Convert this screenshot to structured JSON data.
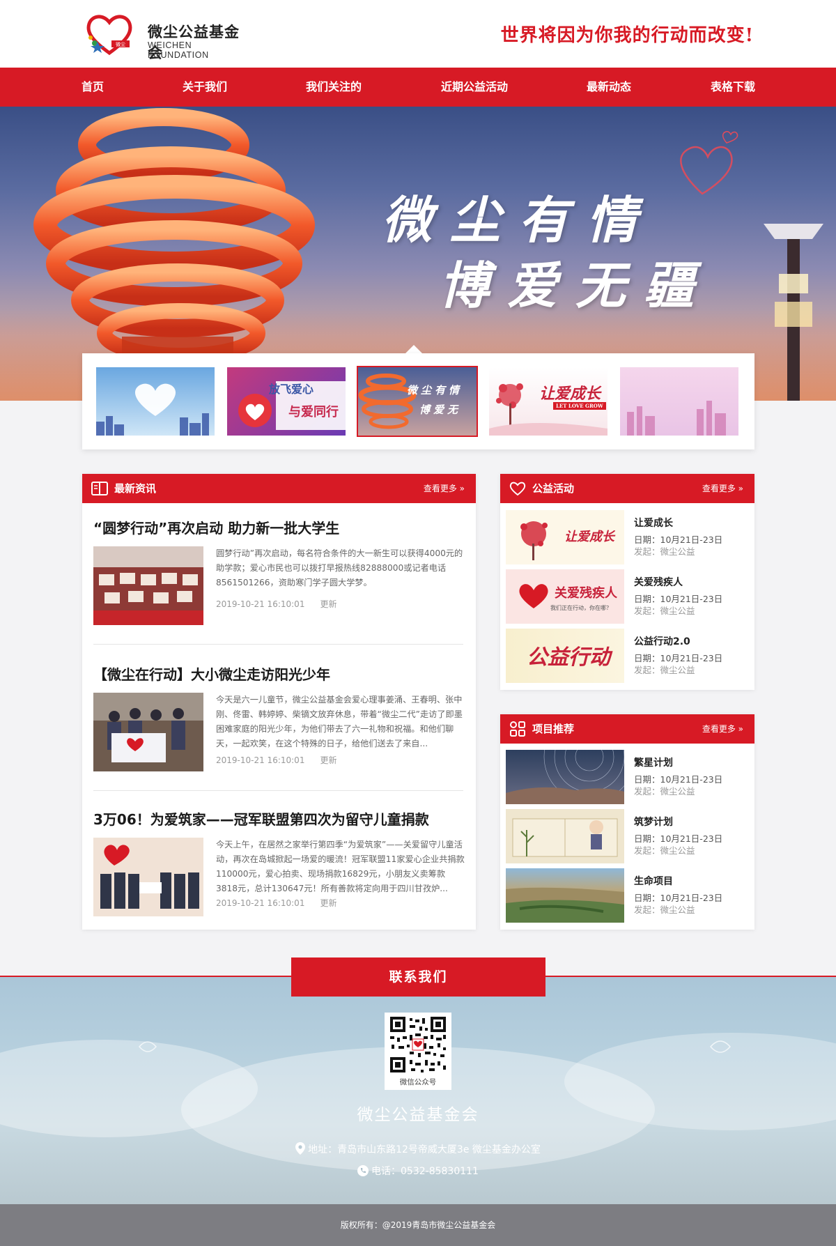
{
  "brand": {
    "name_cn": "微尘公益基金会",
    "name_en": "WEICHEN FOUNDATION",
    "logo_mark_text": "微尘",
    "slogan": "世界将因为你我的行动而改变!"
  },
  "nav": [
    "首页",
    "关于我们",
    "我们关注的",
    "近期公益活动",
    "最新动态",
    "表格下载"
  ],
  "banner": {
    "line1": "微尘有情",
    "line2": "博爱无疆"
  },
  "thumbnails": [
    {
      "name": "heart-cloud-city"
    },
    {
      "name": "fly-love",
      "caption1": "放飞爱心",
      "caption2": "与爱同行"
    },
    {
      "name": "sculpture-banner",
      "caption1": "微尘有情",
      "caption2": "博爱无",
      "active": true
    },
    {
      "name": "let-love-grow",
      "caption1": "让爱成长",
      "caption2": "LET LOVE GROW"
    },
    {
      "name": "pink-city"
    }
  ],
  "news": {
    "title": "最新资讯",
    "more": "查看更多 »",
    "items": [
      {
        "title": "“圆梦行动”再次启动 助力新一批大学生",
        "desc": "圆梦行动”再次启动，每名符合条件的大一新生可以获得4000元的助学款；爱心市民也可以拨打早报热线82888000或记者电话8561501266，资助寒门学子圆大学梦。",
        "date": "2019-10-21 16:10:01",
        "tag": "更新"
      },
      {
        "title": "【微尘在行动】大小微尘走访阳光少年",
        "desc": "今天是六一儿童节，微尘公益基金会爱心理事姜涌、王春明、张中刚、佟雷、韩婷婷、柴镝文放弃休息，带着“微尘二代”走访了即墨困难家庭的阳光少年，为他们带去了六一礼物和祝福。和他们聊天，一起欢笑，在这个特殊的日子，给他们送去了来自...",
        "date": "2019-10-21 16:10:01",
        "tag": "更新"
      },
      {
        "title": "3万06！为爱筑家——冠军联盟第四次为留守儿童捐款",
        "desc": "今天上午，在居然之家举行第四季“为爱筑家”——关爱留守儿童活动，再次在岛城掀起一场爱的暖流！冠军联盟11家爱心企业共捐款110000元，爱心拍卖、现场捐款16829元，小朋友义卖筹款3818元，总计130647元！所有善款将定向用于四川甘孜炉...",
        "date": "2019-10-21 16:10:01",
        "tag": "更新"
      }
    ]
  },
  "activities": {
    "title": "公益活动",
    "more": "查看更多 »",
    "items": [
      {
        "name": "让爱成长",
        "date": "日期：10月21日-23日",
        "source": "发起：微尘公益",
        "thumb_text": "让爱成长"
      },
      {
        "name": "关爱残疾人",
        "date": "日期：10月21日-23日",
        "source": "发起：微尘公益",
        "thumb_text": "关爱残疾人",
        "thumb_sub": "我们正在行动，你在哪？"
      },
      {
        "name": "公益行动2.0",
        "date": "日期：10月21日-23日",
        "source": "发起：微尘公益",
        "thumb_text": "公益行动"
      }
    ]
  },
  "projects": {
    "title": "项目推荐",
    "more": "查看更多 »",
    "items": [
      {
        "name": "繁星计划",
        "date": "日期：10月21日-23日",
        "source": "发起：微尘公益"
      },
      {
        "name": "筑梦计划",
        "date": "日期：10月21日-23日",
        "source": "发起：微尘公益"
      },
      {
        "name": "生命项目",
        "date": "日期：10月21日-23日",
        "source": "发起：微尘公益"
      }
    ]
  },
  "footer": {
    "contact_title": "联系我们",
    "qr_caption": "微信公众号",
    "org_name": "微尘公益基金会",
    "address": "地址：青岛市山东路12号帝威大厦3e 微尘基金办公室",
    "phone": "电话：0532-85830111",
    "copyright": "版权所有：@2019青岛市微尘公益基金会"
  },
  "colors": {
    "accent": "#d71a25",
    "footer_bar": "#7d7d82"
  }
}
